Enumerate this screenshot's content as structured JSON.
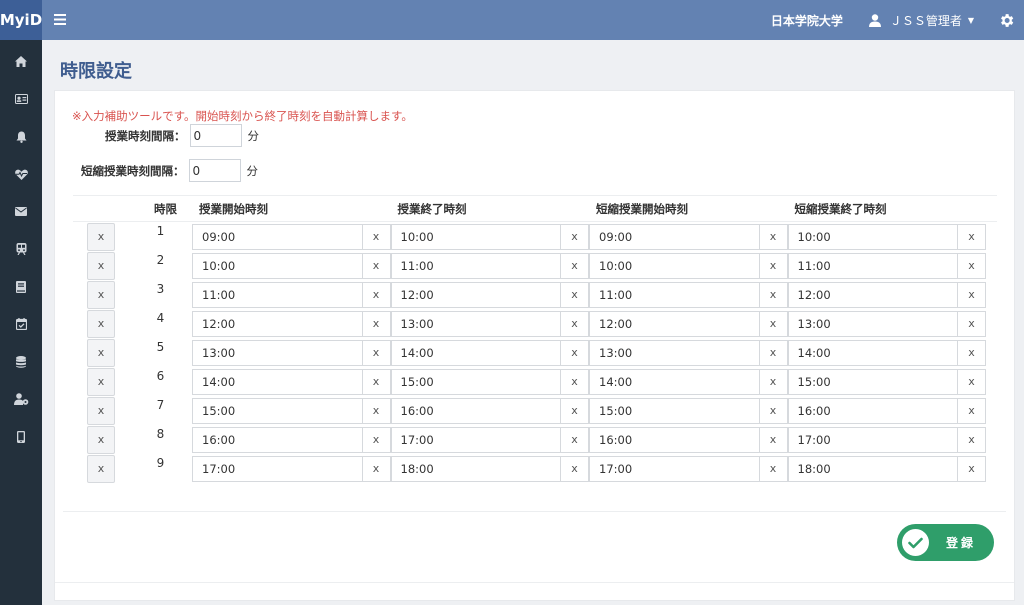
{
  "app": {
    "brand": "MyiD",
    "org": "日本学院大学",
    "user": "ＪＳＳ管理者"
  },
  "sidebar": {
    "items": [
      {
        "icon": "home-icon"
      },
      {
        "icon": "id-card-icon"
      },
      {
        "icon": "bell-icon"
      },
      {
        "icon": "heartbeat-icon"
      },
      {
        "icon": "envelope-icon"
      },
      {
        "icon": "train-icon"
      },
      {
        "icon": "book-icon"
      },
      {
        "icon": "calendar-check-icon"
      },
      {
        "icon": "database-icon"
      },
      {
        "icon": "user-cog-icon"
      },
      {
        "icon": "mobile-icon"
      }
    ]
  },
  "page": {
    "title": "時限設定"
  },
  "helper": {
    "note": "※入力補助ツールです。開始時刻から終了時刻を自動計算します。",
    "interval_label": "授業時刻間隔：",
    "interval_value": "0",
    "short_interval_label": "短縮授業時刻間隔：",
    "short_interval_value": "0",
    "unit": "分"
  },
  "table": {
    "headers": {
      "period": "時限",
      "start": "授業開始時刻",
      "end": "授業終了時刻",
      "short_start": "短縮授業開始時刻",
      "short_end": "短縮授業終了時刻"
    },
    "delete_label": "x",
    "clear_label": "x",
    "rows": [
      {
        "period": "1",
        "start": "09:00",
        "end": "10:00",
        "short_start": "09:00",
        "short_end": "10:00"
      },
      {
        "period": "2",
        "start": "10:00",
        "end": "11:00",
        "short_start": "10:00",
        "short_end": "11:00"
      },
      {
        "period": "3",
        "start": "11:00",
        "end": "12:00",
        "short_start": "11:00",
        "short_end": "12:00"
      },
      {
        "period": "4",
        "start": "12:00",
        "end": "13:00",
        "short_start": "12:00",
        "short_end": "13:00"
      },
      {
        "period": "5",
        "start": "13:00",
        "end": "14:00",
        "short_start": "13:00",
        "short_end": "14:00"
      },
      {
        "period": "6",
        "start": "14:00",
        "end": "15:00",
        "short_start": "14:00",
        "short_end": "15:00"
      },
      {
        "period": "7",
        "start": "15:00",
        "end": "16:00",
        "short_start": "15:00",
        "short_end": "16:00"
      },
      {
        "period": "8",
        "start": "16:00",
        "end": "17:00",
        "short_start": "16:00",
        "short_end": "17:00"
      },
      {
        "period": "9",
        "start": "17:00",
        "end": "18:00",
        "short_start": "17:00",
        "short_end": "18:00"
      }
    ]
  },
  "submit": {
    "label": "登録"
  },
  "colors": {
    "topbar": "#6382b2",
    "brand": "#3d5f97",
    "sidebar": "#23303c",
    "title": "#3f5d8f",
    "note": "#d9534f",
    "submit": "#2f9e6a"
  }
}
